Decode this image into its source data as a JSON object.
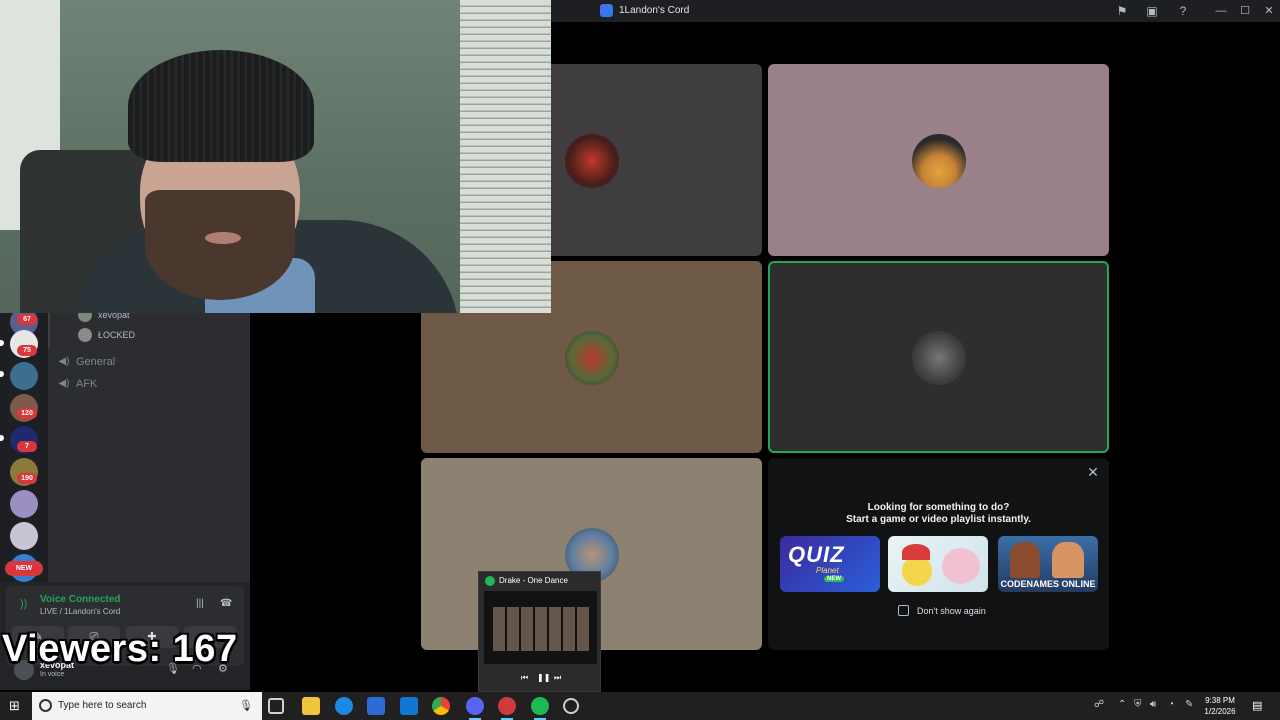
{
  "window": {
    "title": "1Landon's Cord"
  },
  "sidebar": {
    "badges": [
      "67",
      "75",
      "120",
      "7",
      "190"
    ],
    "new_label": "NEW",
    "voice_users": [
      {
        "name": "xevopat"
      },
      {
        "name": "ŁOCKED"
      }
    ],
    "channels": [
      {
        "name": "General",
        "icon": "speaker-icon"
      },
      {
        "name": "AFK",
        "icon": "speaker-icon"
      }
    ]
  },
  "voice_panel": {
    "status": "Voice Connected",
    "subtitle": "LIVE / 1Landon's Cord",
    "user_name": "xevopat",
    "user_status": "In voice"
  },
  "overlay": {
    "viewers": "Viewers: 167"
  },
  "activities": {
    "line1": "Looking for something to do?",
    "line2": "Start a game or video playlist instantly.",
    "cards": [
      {
        "name": "Quiz Planet",
        "title": "QUIZ",
        "subtitle": "Planet",
        "tag": "NEW"
      },
      {
        "name": "Christmas duck"
      },
      {
        "name": "Codenames Online",
        "title": "CODENAMES ONLINE"
      }
    ],
    "dont_show": "Don't show again"
  },
  "spotify": {
    "track": "Drake - One Dance"
  },
  "taskbar": {
    "search_placeholder": "Type here to search",
    "time": "9:38 PM",
    "date": "1/2/2026"
  },
  "colors": {
    "accent_green": "#23a55a",
    "badge_red": "#da373c",
    "spotify_green": "#1db954",
    "tile_colors": [
      "#3f3d3d",
      "#9a8088",
      "#6f5a48",
      "#2e2e2e",
      "#8d8272"
    ]
  }
}
